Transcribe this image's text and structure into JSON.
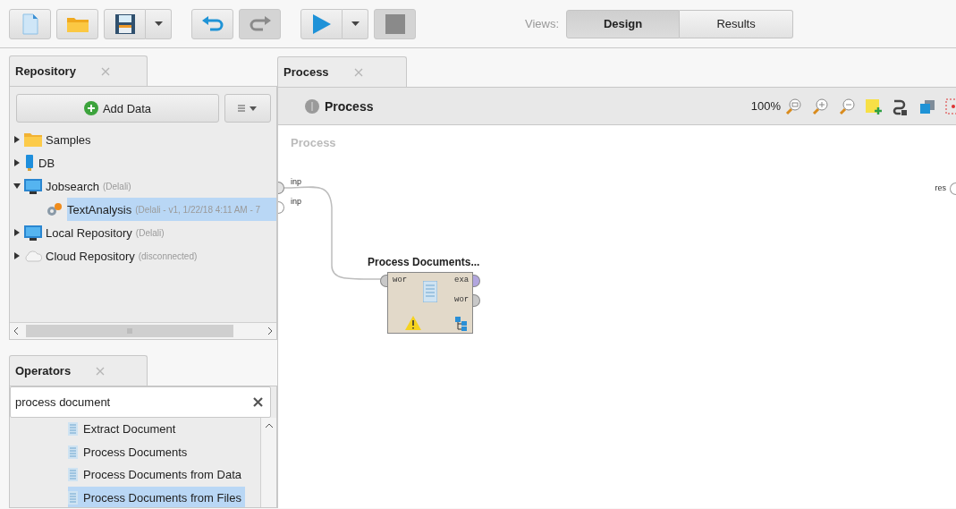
{
  "toolbar": [
    {
      "kind": "new",
      "disabled": false,
      "dropdown": false
    },
    {
      "kind": "open",
      "disabled": false,
      "dropdown": false
    },
    {
      "kind": "save",
      "disabled": false,
      "dropdown": true
    },
    {
      "kind": "undo",
      "disabled": false,
      "dropdown": false
    },
    {
      "kind": "redo",
      "disabled": true,
      "dropdown": false
    },
    {
      "kind": "run",
      "disabled": false,
      "dropdown": true
    },
    {
      "kind": "stop",
      "disabled": true,
      "dropdown": false
    }
  ],
  "views": {
    "label": "Views:",
    "options": [
      {
        "label": "Design",
        "selected": true
      },
      {
        "label": "Results",
        "selected": false
      }
    ]
  },
  "repository": {
    "tab": "Repository",
    "add_button": "Add Data",
    "tree": [
      {
        "kind": "folder",
        "label": "Samples",
        "expanded": false,
        "selected": false
      },
      {
        "kind": "database",
        "label": "DB",
        "expanded": false,
        "selected": false
      },
      {
        "kind": "monitor",
        "label": "Jobsearch",
        "note": "(Delali)",
        "expanded": true,
        "selected": false,
        "children": [
          {
            "kind": "process",
            "label": "TextAnalysis",
            "note": "(Delali - v1, 1/22/18 4:11 AM - 7",
            "selected": true
          }
        ]
      },
      {
        "kind": "monitor",
        "label": "Local Repository",
        "note": "(Delali)",
        "expanded": false,
        "selected": false
      },
      {
        "kind": "cloud",
        "label": "Cloud Repository",
        "note": "(disconnected)",
        "expanded": false,
        "selected": false
      }
    ]
  },
  "operators": {
    "tab": "Operators",
    "search": {
      "value": "process document"
    },
    "items": [
      {
        "label": "Extract Document",
        "selected": false
      },
      {
        "label": "Process Documents",
        "selected": false
      },
      {
        "label": "Process Documents from Data",
        "selected": false
      },
      {
        "label": "Process Documents from Files",
        "selected": true
      }
    ]
  },
  "process": {
    "tab": "Process",
    "breadcrumb": "Process",
    "zoom": "100%",
    "canvas_title": "Process",
    "inputs": [
      {
        "label": "inp",
        "connected": true
      },
      {
        "label": "inp",
        "connected": false
      }
    ],
    "outputs": [
      {
        "label": "res"
      }
    ],
    "operator": {
      "title": "Process Documents...",
      "warning": true,
      "in_ports": [
        {
          "label": "wor",
          "color": "#c8c8c8"
        }
      ],
      "out_ports": [
        {
          "label": "exa",
          "color": "#b2a6de"
        },
        {
          "label": "wor",
          "color": "#c8c8c8"
        }
      ]
    }
  }
}
